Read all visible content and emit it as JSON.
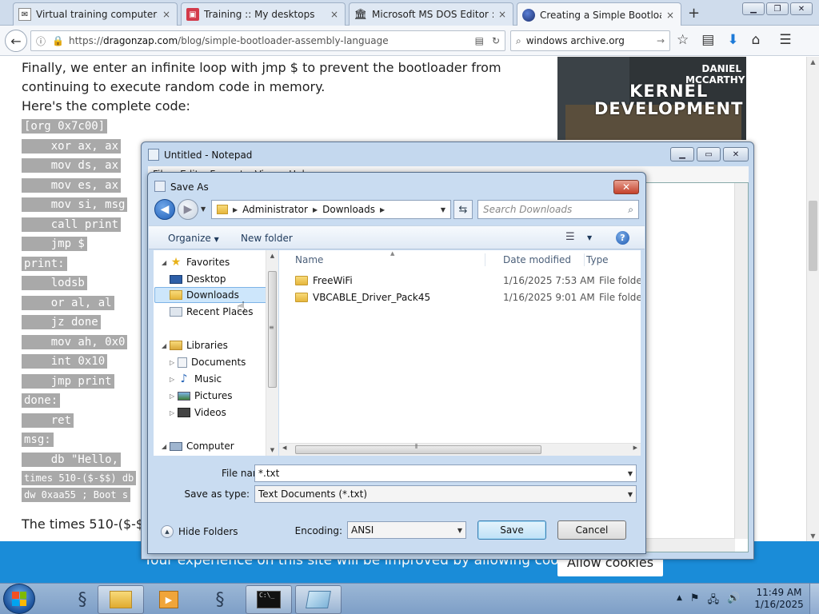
{
  "browser": {
    "tabs": [
      {
        "label": "Virtual training computers f",
        "icon": "mail-icon",
        "close": "×"
      },
      {
        "label": "Training :: My desktops",
        "icon": "training-icon",
        "close": "×"
      },
      {
        "label": "Microsoft MS DOS Editor : F",
        "icon": "archive-icon",
        "close": "×"
      },
      {
        "label": "Creating a Simple Bootloade",
        "icon": "globe-icon",
        "close": "×"
      }
    ],
    "new_tab": "+",
    "url_domain": "dragonzap.com",
    "url_prefix": "https://",
    "url_path": "/blog/simple-bootloader-assembly-language",
    "search_value": "windows archive.org"
  },
  "article": {
    "para1": "Finally, we enter an infinite loop with jmp $ to prevent the bootloader from",
    "para2": "continuing to execute random code in memory.",
    "para3": "Here's the complete code:",
    "para4": "The times 510-($-$",
    "code_lines": [
      "[org 0x7c00]",
      "    xor ax, ax",
      "    mov ds, ax",
      "    mov es, ax",
      "    mov si, msg",
      "    call print",
      "    jmp $",
      "print:",
      "    lodsb",
      "    or al, al",
      "    jz done",
      "    mov ah, 0x0",
      "    int 0x10",
      "    jmp print",
      "done:",
      "    ret",
      "msg:",
      "    db \"Hello,",
      "times 510-($-$$) db",
      "dw 0xaa55 ; Boot s"
    ],
    "promo_author": "DANIEL MCCARTHY",
    "promo_title_1": "KERNEL",
    "promo_title_2": "DEVELOPMENT"
  },
  "cookie": {
    "text": "Your experience on this site will be improved by allowing cookies.",
    "button": "Allow cookies"
  },
  "notepad": {
    "title": "Untitled - Notepad",
    "menu": [
      "File",
      "Edit",
      "Format",
      "View",
      "Help"
    ]
  },
  "saveas": {
    "title": "Save As",
    "breadcrumb": [
      "Administrator",
      "Downloads"
    ],
    "search_placeholder": "Search Downloads",
    "organize": "Organize",
    "new_folder": "New folder",
    "help": "?",
    "tree": [
      {
        "label": "Favorites",
        "icon": "star-icon"
      },
      {
        "label": "Desktop",
        "icon": "desktop-icon"
      },
      {
        "label": "Downloads",
        "icon": "downloads-folder-icon"
      },
      {
        "label": "Recent Places",
        "icon": "recent-places-icon"
      },
      {
        "label": "Libraries",
        "icon": "libraries-icon"
      },
      {
        "label": "Documents",
        "icon": "documents-icon"
      },
      {
        "label": "Music",
        "icon": "music-icon"
      },
      {
        "label": "Pictures",
        "icon": "pictures-icon"
      },
      {
        "label": "Videos",
        "icon": "videos-icon"
      },
      {
        "label": "Computer",
        "icon": "computer-icon"
      }
    ],
    "columns": [
      "Name",
      "Date modified",
      "Type"
    ],
    "files": [
      {
        "name": "FreeWiFi",
        "date": "1/16/2025 7:53 AM",
        "type": "File folder"
      },
      {
        "name": "VBCABLE_Driver_Pack45",
        "date": "1/16/2025 9:01 AM",
        "type": "File folder"
      }
    ],
    "file_name_label": "File name:",
    "file_name_value": "*.txt",
    "save_type_label": "Save as type:",
    "save_type_value": "Text Documents (*.txt)",
    "hide_folders": "Hide Folders",
    "encoding_label": "Encoding:",
    "encoding_value": "ANSI",
    "save_button": "Save",
    "cancel_button": "Cancel"
  },
  "taskbar": {
    "time": "11:49 AM",
    "date": "1/16/2025"
  }
}
